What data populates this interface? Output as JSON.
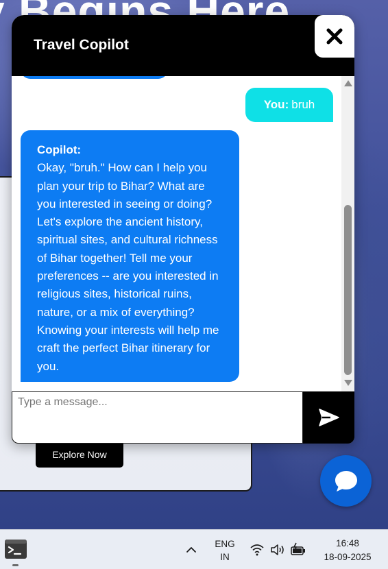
{
  "background": {
    "hero_title": "y Begins Here",
    "explore_button": "Explore Now"
  },
  "chat": {
    "title": "Travel Copilot",
    "close_icon": "close-icon",
    "user_message": {
      "sender": "You:",
      "text": "bruh"
    },
    "bot_message": {
      "sender": "Copilot:",
      "text": "Okay, \"bruh.\" How can I help you plan your trip to Bihar? What are you interested in seeing or doing? Let's explore the ancient history, spiritual sites, and cultural richness of Bihar together! Tell me your preferences -- are you interested in religious sites, historical ruins, nature, or a mix of everything? Knowing your interests will help me craft the perfect Bihar itinerary for you."
    },
    "input": {
      "placeholder": "Type a message...",
      "value": ""
    },
    "send_icon": "send-icon",
    "colors": {
      "user_bubble": "#0fe0e6",
      "bot_bubble": "#0d7cf3",
      "header": "#000000",
      "fab": "#0b63d6"
    }
  },
  "fab_icon": "chat-bubble-icon",
  "taskbar": {
    "language_line1": "ENG",
    "language_line2": "IN",
    "time": "16:48",
    "date": "18-09-2025"
  }
}
